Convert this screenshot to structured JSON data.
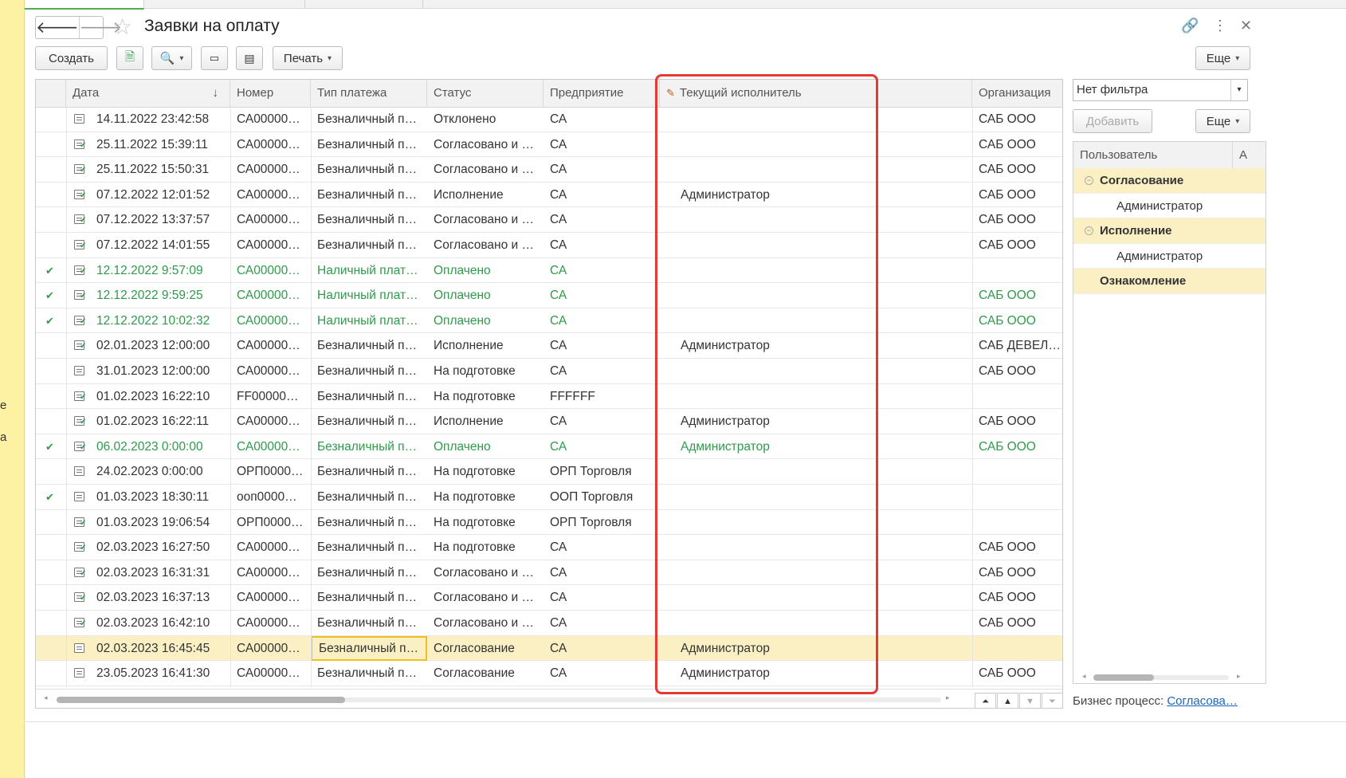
{
  "window": {
    "title": "Заявки на оплату",
    "back_icon": "arrow-left-icon",
    "forward_icon": "arrow-right-icon",
    "favorite_icon": "star-icon"
  },
  "left_strip": {
    "fragment_1": "е",
    "fragment_2": "а"
  },
  "toolbar": {
    "create_label": "Создать",
    "print_label": "Печать",
    "more_label": "Еще"
  },
  "table": {
    "columns": [
      "Дата",
      "Номер",
      "Тип платежа",
      "Статус",
      "Предприятие",
      "Текущий исполнитель",
      "Организация"
    ],
    "sort_indicator": "↓",
    "rows": [
      {
        "check": "",
        "icon": "doc",
        "date": "14.11.2022 23:42:58",
        "number": "СА00000…",
        "type": "Безналичный п…",
        "status": "Отклонено",
        "company": "СА",
        "executor": "",
        "org": "САБ ООО",
        "style": "normal"
      },
      {
        "check": "",
        "icon": "doc-ok",
        "date": "25.11.2022 15:39:11",
        "number": "СА00000…",
        "type": "Безналичный п…",
        "status": "Согласовано и …",
        "company": "СА",
        "executor": "",
        "org": "САБ ООО",
        "style": "normal"
      },
      {
        "check": "",
        "icon": "doc-ok",
        "date": "25.11.2022 15:50:31",
        "number": "СА00000…",
        "type": "Безналичный п…",
        "status": "Согласовано и …",
        "company": "СА",
        "executor": "",
        "org": "САБ ООО",
        "style": "normal"
      },
      {
        "check": "",
        "icon": "doc-ok",
        "date": "07.12.2022 12:01:52",
        "number": "СА00000…",
        "type": "Безналичный п…",
        "status": "Исполнение",
        "company": "СА",
        "executor": "Администратор",
        "org": "САБ ООО",
        "style": "normal"
      },
      {
        "check": "",
        "icon": "doc-ok",
        "date": "07.12.2022 13:37:57",
        "number": "СА00000…",
        "type": "Безналичный п…",
        "status": "Согласовано и …",
        "company": "СА",
        "executor": "",
        "org": "САБ ООО",
        "style": "normal"
      },
      {
        "check": "",
        "icon": "doc-ok",
        "date": "07.12.2022 14:01:55",
        "number": "СА00000…",
        "type": "Безналичный п…",
        "status": "Согласовано и …",
        "company": "СА",
        "executor": "",
        "org": "САБ ООО",
        "style": "normal"
      },
      {
        "check": "✔",
        "icon": "doc-ok",
        "date": "12.12.2022 9:57:09",
        "number": "СА00000…",
        "type": "Наличный плат…",
        "status": "Оплачено",
        "company": "СА",
        "executor": "",
        "org": "",
        "style": "green"
      },
      {
        "check": "✔",
        "icon": "doc-ok",
        "date": "12.12.2022 9:59:25",
        "number": "СА00000…",
        "type": "Наличный плат…",
        "status": "Оплачено",
        "company": "СА",
        "executor": "",
        "org": "САБ ООО",
        "style": "green"
      },
      {
        "check": "✔",
        "icon": "doc-ok",
        "date": "12.12.2022 10:02:32",
        "number": "СА00000…",
        "type": "Наличный плат…",
        "status": "Оплачено",
        "company": "СА",
        "executor": "",
        "org": "САБ ООО",
        "style": "green"
      },
      {
        "check": "",
        "icon": "doc-ok",
        "date": "02.01.2023 12:00:00",
        "number": "СА00000…",
        "type": "Безналичный п…",
        "status": "Исполнение",
        "company": "СА",
        "executor": "Администратор",
        "org": "САБ ДЕВЕЛОП",
        "style": "normal"
      },
      {
        "check": "",
        "icon": "doc",
        "date": "31.01.2023 12:00:00",
        "number": "СА00000…",
        "type": "Безналичный п…",
        "status": "На подготовке",
        "company": "СА",
        "executor": "",
        "org": "САБ ООО",
        "style": "normal"
      },
      {
        "check": "",
        "icon": "doc-ok",
        "date": "01.02.2023 16:22:10",
        "number": "FF00000…",
        "type": "Безналичный п…",
        "status": "На подготовке",
        "company": "FFFFFF",
        "executor": "",
        "org": "",
        "style": "normal"
      },
      {
        "check": "",
        "icon": "doc-ok",
        "date": "01.02.2023 16:22:11",
        "number": "СА00000…",
        "type": "Безналичный п…",
        "status": "Исполнение",
        "company": "СА",
        "executor": "Администратор",
        "org": "САБ ООО",
        "style": "normal"
      },
      {
        "check": "✔",
        "icon": "doc-ok",
        "date": "06.02.2023 0:00:00",
        "number": "СА00000…",
        "type": "Безналичный п…",
        "status": "Оплачено",
        "company": "СА",
        "executor": "Администратор",
        "org": "САБ ООО",
        "style": "green"
      },
      {
        "check": "",
        "icon": "doc",
        "date": "24.02.2023 0:00:00",
        "number": "ОРП0000…",
        "type": "Безналичный п…",
        "status": "На подготовке",
        "company": "ОРП Торговля",
        "executor": "",
        "org": "",
        "style": "normal"
      },
      {
        "check": "✔",
        "icon": "doc",
        "date": "01.03.2023 18:30:11",
        "number": "ооп0000…",
        "type": "Безналичный п…",
        "status": "На подготовке",
        "company": "ООП Торговля",
        "executor": "",
        "org": "",
        "style": "normal"
      },
      {
        "check": "",
        "icon": "doc-ok",
        "date": "01.03.2023 19:06:54",
        "number": "ОРП0000…",
        "type": "Безналичный п…",
        "status": "На подготовке",
        "company": "ОРП Торговля",
        "executor": "",
        "org": "",
        "style": "normal"
      },
      {
        "check": "",
        "icon": "doc-ok",
        "date": "02.03.2023 16:27:50",
        "number": "СА00000…",
        "type": "Безналичный п…",
        "status": "На подготовке",
        "company": "СА",
        "executor": "",
        "org": "САБ ООО",
        "style": "normal"
      },
      {
        "check": "",
        "icon": "doc-ok",
        "date": "02.03.2023 16:31:31",
        "number": "СА00000…",
        "type": "Безналичный п…",
        "status": "Согласовано и …",
        "company": "СА",
        "executor": "",
        "org": "САБ ООО",
        "style": "normal"
      },
      {
        "check": "",
        "icon": "doc-ok",
        "date": "02.03.2023 16:37:13",
        "number": "СА00000…",
        "type": "Безналичный п…",
        "status": "Согласовано и …",
        "company": "СА",
        "executor": "",
        "org": "САБ ООО",
        "style": "normal"
      },
      {
        "check": "",
        "icon": "doc-ok",
        "date": "02.03.2023 16:42:10",
        "number": "СА00000…",
        "type": "Безналичный п…",
        "status": "Согласовано и …",
        "company": "СА",
        "executor": "",
        "org": "САБ ООО",
        "style": "normal"
      },
      {
        "check": "",
        "icon": "doc",
        "date": "02.03.2023 16:45:45",
        "number": "СА00000…",
        "type": "Безналичный п…",
        "status": "Согласование",
        "company": "СА",
        "executor": "Администратор",
        "org": "",
        "style": "selected"
      },
      {
        "check": "",
        "icon": "doc",
        "date": "23.05.2023 16:41:30",
        "number": "СА00000…",
        "type": "Безналичный п…",
        "status": "Согласование",
        "company": "СА",
        "executor": "Администратор",
        "org": "САБ ООО",
        "style": "normal"
      }
    ]
  },
  "right_panel": {
    "filter_value": "Нет фильтра",
    "add_label": "Добавить",
    "more_label": "Еще",
    "columns": [
      "Пользователь",
      "А"
    ],
    "tree": [
      {
        "label": "Согласование",
        "level": 0,
        "group": true
      },
      {
        "label": "Администратор",
        "level": 1,
        "group": false
      },
      {
        "label": "Исполнение",
        "level": 0,
        "group": true
      },
      {
        "label": "Администратор",
        "level": 1,
        "group": false
      },
      {
        "label": "Ознакомление",
        "level": 0,
        "group": true
      }
    ],
    "business_process_label": "Бизнес процесс:",
    "business_process_link": "Согласова…"
  },
  "colors": {
    "accent_green": "#2e9b49",
    "highlight_red": "#e53935",
    "selection": "#fbf0c4"
  }
}
